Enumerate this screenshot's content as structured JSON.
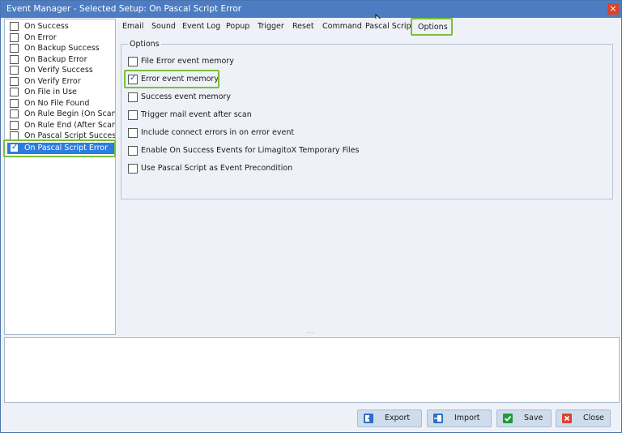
{
  "window": {
    "title": "Event Manager - Selected Setup: On Pascal Script Error",
    "close_glyph": "×"
  },
  "event_list": {
    "items": [
      {
        "label": "On Success",
        "checked": false
      },
      {
        "label": "On Error",
        "checked": false
      },
      {
        "label": "On Backup Success",
        "checked": false
      },
      {
        "label": "On Backup Error",
        "checked": false
      },
      {
        "label": "On Verify Success",
        "checked": false
      },
      {
        "label": "On Verify Error",
        "checked": false
      },
      {
        "label": "On File in Use",
        "checked": false
      },
      {
        "label": "On No File Found",
        "checked": false
      },
      {
        "label": "On Rule Begin (On Scan)",
        "checked": false
      },
      {
        "label": "On Rule End (After Scan)",
        "checked": false
      },
      {
        "label": "On Pascal Script Success",
        "checked": false
      },
      {
        "label": "On Pascal Script Error",
        "checked": true,
        "selected": true
      }
    ]
  },
  "tabs": {
    "items": [
      "Email",
      "Sound",
      "Event Log",
      "Popup",
      "Trigger",
      "Reset",
      "Command",
      "Pascal Script",
      "Options"
    ],
    "active": "Options"
  },
  "options": {
    "group_title": "Options",
    "items": [
      {
        "label": "File Error event memory",
        "checked": false
      },
      {
        "label": "Error event memory",
        "checked": true
      },
      {
        "label": "Success event memory",
        "checked": false
      },
      {
        "label": "Trigger mail event after scan",
        "checked": false
      },
      {
        "label": "Include connect errors in on error event",
        "checked": false
      },
      {
        "label": "Enable On Success Events for LimagitoX Temporary Files",
        "checked": false
      },
      {
        "label": "Use Pascal Script as Event Precondition",
        "checked": false
      }
    ]
  },
  "buttons": {
    "export": "Export",
    "import": "Import",
    "save": "Save",
    "close": "Close"
  },
  "colors": {
    "titlebar": "#4d7cc2",
    "selection": "#2b7de0",
    "highlight_frame": "#7cbf3a",
    "close_red": "#d9442b",
    "save_green": "#1e9b3a"
  },
  "glyphs": {
    "check": "✓",
    "splitter": "....."
  }
}
